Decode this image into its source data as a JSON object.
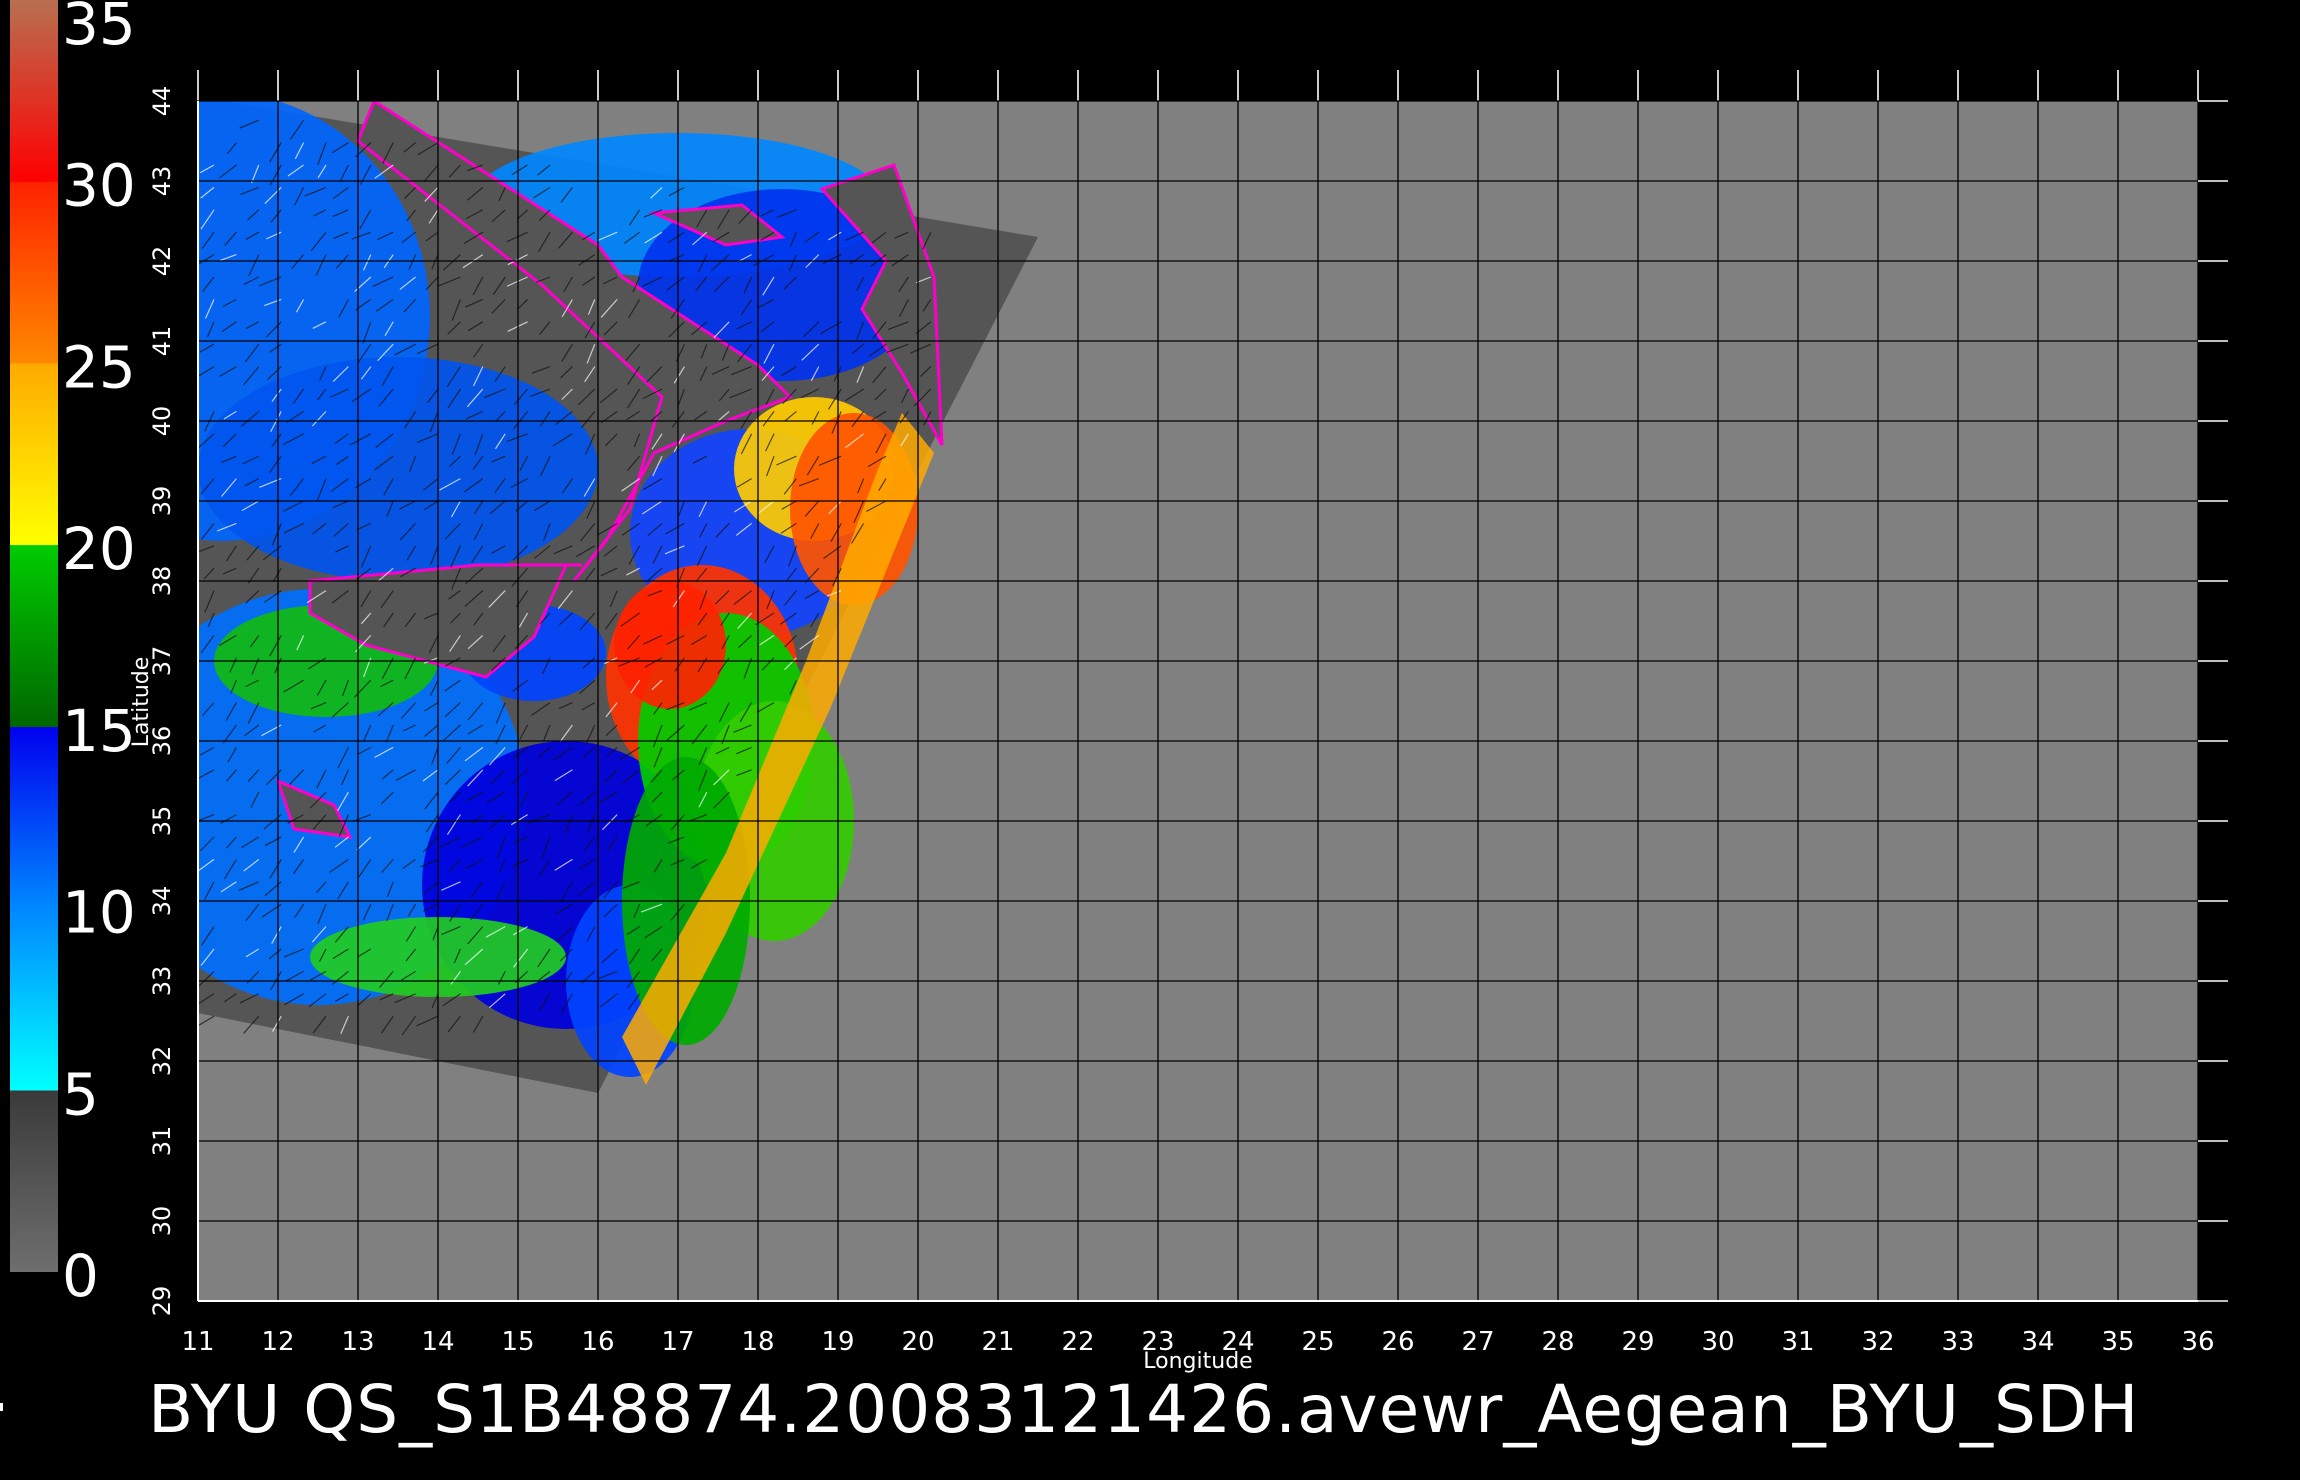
{
  "title": "BYU  QS_S1B48874.20083121426.avewr_Aegean_BYU_SDH",
  "colorbar": {
    "labels": [
      "35",
      "30",
      "25",
      "20",
      "15",
      "10",
      "5",
      "0"
    ],
    "stops": [
      {
        "from": 0,
        "to": 5,
        "colors": [
          "#6e6e6e",
          "#3a3a3a"
        ]
      },
      {
        "from": 5,
        "to": 10,
        "colors": [
          "#00ffff",
          "#0088ff"
        ]
      },
      {
        "from": 10,
        "to": 15,
        "colors": [
          "#0088ff",
          "#0000ee"
        ]
      },
      {
        "from": 15,
        "to": 20,
        "colors": [
          "#006600",
          "#00cc00"
        ]
      },
      {
        "from": 20,
        "to": 25,
        "colors": [
          "#ffff00",
          "#ffaa00"
        ]
      },
      {
        "from": 25,
        "to": 30,
        "colors": [
          "#ff8800",
          "#ff2200"
        ]
      },
      {
        "from": 30,
        "to": 35,
        "colors": [
          "#ff0000",
          "#b87050"
        ]
      }
    ]
  },
  "map": {
    "x_axis": {
      "label": "Longitude",
      "min": 11,
      "max": 36,
      "ticks": [
        "11",
        "12",
        "13",
        "14",
        "15",
        "16",
        "17",
        "18",
        "19",
        "20",
        "21",
        "22",
        "23",
        "24",
        "25",
        "26",
        "27",
        "28",
        "29",
        "30",
        "31",
        "32",
        "33",
        "34",
        "35",
        "36"
      ]
    },
    "y_axis": {
      "label": "Latitude",
      "min": 29,
      "max": 44,
      "ticks": [
        "29",
        "30",
        "31",
        "32",
        "33",
        "34",
        "35",
        "36",
        "37",
        "38",
        "39",
        "40",
        "41",
        "42",
        "43",
        "44"
      ]
    },
    "background_color": "#808080",
    "swath_color": "#555555",
    "grid_color": "#000000",
    "swath_corners": [
      [
        11,
        44.05
      ],
      [
        21.5,
        42.3
      ],
      [
        16.0,
        31.6
      ],
      [
        11,
        32.6
      ]
    ]
  }
}
